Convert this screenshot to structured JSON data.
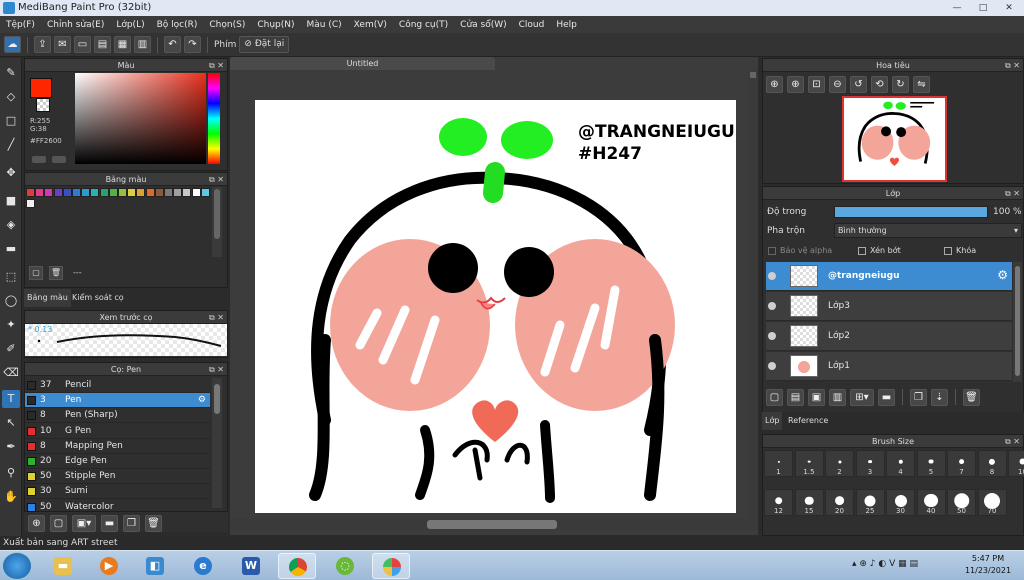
{
  "window": {
    "title": "MediBang Paint Pro (32bit)",
    "minimize": "—",
    "maximize": "□",
    "close": "✕"
  },
  "menu": [
    "Tệp(F)",
    "Chỉnh sửa(E)",
    "Lớp(L)",
    "Bộ lọc(R)",
    "Chọn(S)",
    "Chụp(N)",
    "Màu (C)",
    "Xem(V)",
    "Công cụ(T)",
    "Cửa sổ(W)",
    "Cloud",
    "Help"
  ],
  "toolbar": {
    "shortcut_label": "Phím",
    "reset_label": "Đặt lại"
  },
  "color_panel": {
    "title": "Màu",
    "r": "R:255",
    "g": "G:38",
    "hex": "#FF2600",
    "primary": "#ff2600"
  },
  "palette_panel": {
    "title": "Bảng màu",
    "footer": "---",
    "colors": [
      "#e23a3a",
      "#e03c8a",
      "#d03ab0",
      "#6e3fc0",
      "#3a4fc0",
      "#2c7cd0",
      "#2c9cd0",
      "#2ab0b0",
      "#2aa070",
      "#56b04a",
      "#98c03a",
      "#d8d040",
      "#e0a030",
      "#e06a28",
      "#8a5a3a",
      "#7a7a7a",
      "#a0a0a0",
      "#c8c8c8",
      "#ffffff",
      "#5ac8e8",
      "#f0f0f0"
    ]
  },
  "tabs_left": {
    "tab1": "Bảng màu",
    "tab2": "Kiểm soát cọ"
  },
  "brush_preview": {
    "title": "Xem trước cọ",
    "size": "0.13"
  },
  "brush_panel": {
    "title": "Cọ: Pen",
    "items": [
      {
        "size": "37",
        "name": "Pencil",
        "color": "#2a2a2a"
      },
      {
        "size": "3",
        "name": "Pen",
        "color": "#2a2a2a",
        "selected": true
      },
      {
        "size": "8",
        "name": "Pen (Sharp)",
        "color": "#2a2a2a"
      },
      {
        "size": "10",
        "name": "G Pen",
        "color": "#e03030"
      },
      {
        "size": "8",
        "name": "Mapping Pen",
        "color": "#e03030"
      },
      {
        "size": "20",
        "name": "Edge Pen",
        "color": "#30b030"
      },
      {
        "size": "50",
        "name": "Stipple Pen",
        "color": "#e0d030"
      },
      {
        "size": "30",
        "name": "Sumi",
        "color": "#e0d030"
      },
      {
        "size": "50",
        "name": "Watercolor",
        "color": "#3080e0"
      }
    ]
  },
  "document": {
    "tab": "Untitled",
    "text1": "@TRANGNEIUGU",
    "text2": "#H247"
  },
  "navigator": {
    "title": "Hoa tiêu"
  },
  "layer_panel": {
    "title": "Lớp",
    "opacity_label": "Độ trong",
    "opacity_value": "100 %",
    "opacity": 1.0,
    "blend_label": "Pha trộn",
    "blend_value": "Bình thường",
    "protect_alpha": "Bảo vệ alpha",
    "clipping": "Xén bớt",
    "lock": "Khóa",
    "layers": [
      {
        "name": "@trangneiugu",
        "selected": true
      },
      {
        "name": "Lớp3"
      },
      {
        "name": "Lớp2"
      },
      {
        "name": "Lớp1"
      }
    ],
    "tab1": "Lớp",
    "tab2": "Reference"
  },
  "brush_size_panel": {
    "title": "Brush Size",
    "row1": [
      "1",
      "1.5",
      "2",
      "3",
      "4",
      "5",
      "7",
      "8",
      "10"
    ],
    "row2": [
      "12",
      "15",
      "20",
      "25",
      "30",
      "40",
      "50",
      "70"
    ]
  },
  "status": {
    "text": "Xuất bản sang ART street"
  },
  "taskbar": {
    "time": "5:47 PM",
    "date": "11/23/2021"
  }
}
